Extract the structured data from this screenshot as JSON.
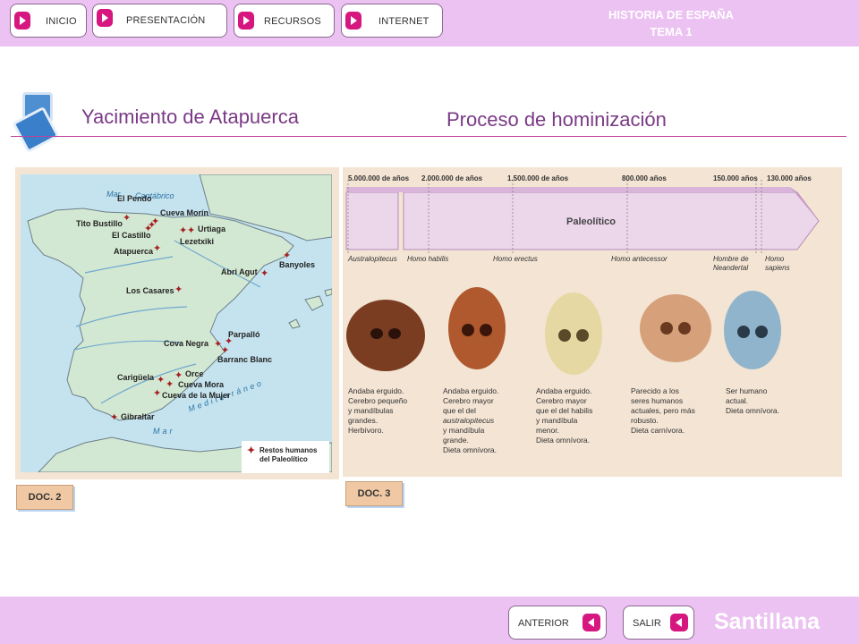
{
  "header": {
    "nav": [
      {
        "label": "INICIO"
      },
      {
        "label": "PRESENTACIÓN"
      },
      {
        "label": "RECURSOS"
      },
      {
        "label": "INTERNET"
      }
    ],
    "course_line1": "HISTORIA DE ESPAÑA",
    "course_line2": "TEMA 1"
  },
  "titles": {
    "left": "Yacimiento de Atapuerca",
    "right": "Proceso de hominización"
  },
  "map": {
    "sea_labels": [
      "Mar",
      "Cantábrico",
      "Mediterráneo",
      "Mar"
    ],
    "sites": [
      "El Pendo",
      "Cueva Morín",
      "Tito Bustillo",
      "Urtiaga",
      "El Castillo",
      "Lezetxiki",
      "Atapuerca",
      "Banyoles",
      "Abri Agut",
      "Los Casares",
      "Parpalló",
      "Cova Negra",
      "Barranc Blanc",
      "Orce",
      "Carigüela",
      "Cueva Mora",
      "Cueva de la Mujer",
      "Gibraltar"
    ],
    "legend_line1": "Restos humanos",
    "legend_line2": "del Paleolítico",
    "doc_label": "DOC. 2"
  },
  "timeline": {
    "years": [
      "5.000.000 de años",
      "2.000.000 de años",
      "1.500.000 de años",
      "800.000 años",
      "150.000 años",
      "130.000 años"
    ],
    "band_label": "Paleolítico",
    "species": [
      "Australopitecus",
      "Homo habilis",
      "Homo erectus",
      "Homo antecessor",
      "Hombre de Neandertal",
      "Homo sapiens"
    ],
    "descriptions": [
      [
        "Andaba erguido.",
        "Cerebro pequeño",
        "y mandíbulas",
        "grandes.",
        "Herbívoro."
      ],
      [
        "Andaba erguido.",
        "Cerebro mayor",
        "que el del",
        "australopitecus",
        "y mandíbula",
        "grande.",
        "Dieta omnívora."
      ],
      [
        "Andaba erguido.",
        "Cerebro mayor",
        "que el del habilis",
        "y mandíbula",
        "menor.",
        "Dieta omnívora."
      ],
      [
        "Parecido a los",
        "seres humanos",
        "actuales, pero más",
        "robusto.",
        "Dieta carnívora."
      ],
      [
        "Ser humano",
        "actual.",
        "Dieta omnívora."
      ]
    ],
    "doc_label": "DOC. 3"
  },
  "footer": {
    "prev_label": "ANTERIOR",
    "exit_label": "SALIR",
    "brand": "Santillana"
  },
  "colors": {
    "bar": "#ecc2f2",
    "accent": "#d6177f",
    "title": "#7a3a86",
    "rule": "#c0409a",
    "land": "#d3e8d2",
    "sea": "#c5e3ee"
  }
}
